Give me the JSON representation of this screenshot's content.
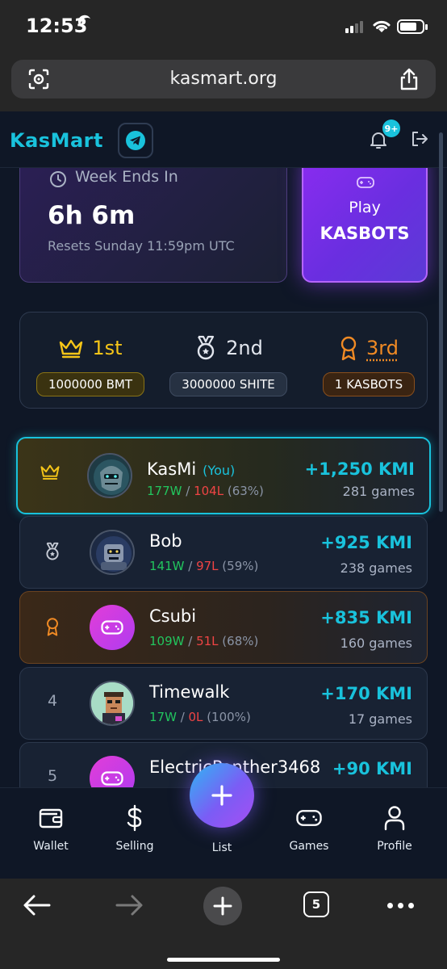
{
  "status_bar": {
    "time": "12:53"
  },
  "browser": {
    "url": "kasmart.org",
    "tab_count": "5"
  },
  "header": {
    "logo": "KasMart",
    "notification_badge": "9+"
  },
  "week": {
    "label": "Week Ends In",
    "time_left": "6h 6m",
    "reset_note": "Resets Sunday 11:59pm UTC"
  },
  "play": {
    "label": "Play",
    "game": "KASBOTS"
  },
  "prizes": [
    {
      "rank": "1st",
      "prize": "1000000 BMT",
      "color": "#f5c518"
    },
    {
      "rank": "2nd",
      "prize": "3000000 SHITE",
      "color": "#e2e6ee"
    },
    {
      "rank": "3rd",
      "prize": "1 KASBOTS",
      "color": "#f08a24"
    }
  ],
  "leaderboard": [
    {
      "rank": "",
      "name": "KasMi",
      "you_tag": "(You)",
      "wins": "177W",
      "losses": "104L",
      "pct": "(63%)",
      "kmi": "+1,250 KMI",
      "games": "281 games"
    },
    {
      "rank": "",
      "name": "Bob",
      "wins": "141W",
      "losses": "97L",
      "pct": "(59%)",
      "kmi": "+925 KMI",
      "games": "238 games"
    },
    {
      "rank": "",
      "name": "Csubi",
      "wins": "109W",
      "losses": "51L",
      "pct": "(68%)",
      "kmi": "+835 KMI",
      "games": "160 games"
    },
    {
      "rank": "4",
      "name": "Timewalk",
      "wins": "17W",
      "losses": "0L",
      "pct": "(100%)",
      "kmi": "+170 KMI",
      "games": "17 games"
    },
    {
      "rank": "5",
      "name": "ElectricPanther3468",
      "kmi": "+90 KMI"
    }
  ],
  "nav": {
    "wallet": "Wallet",
    "selling": "Selling",
    "list": "List",
    "games": "Games",
    "profile": "Profile"
  },
  "colors": {
    "accent": "#19c2dc",
    "win": "#22c55e",
    "loss": "#ef4444",
    "gold": "#f5c518",
    "bronze": "#f08a24"
  }
}
